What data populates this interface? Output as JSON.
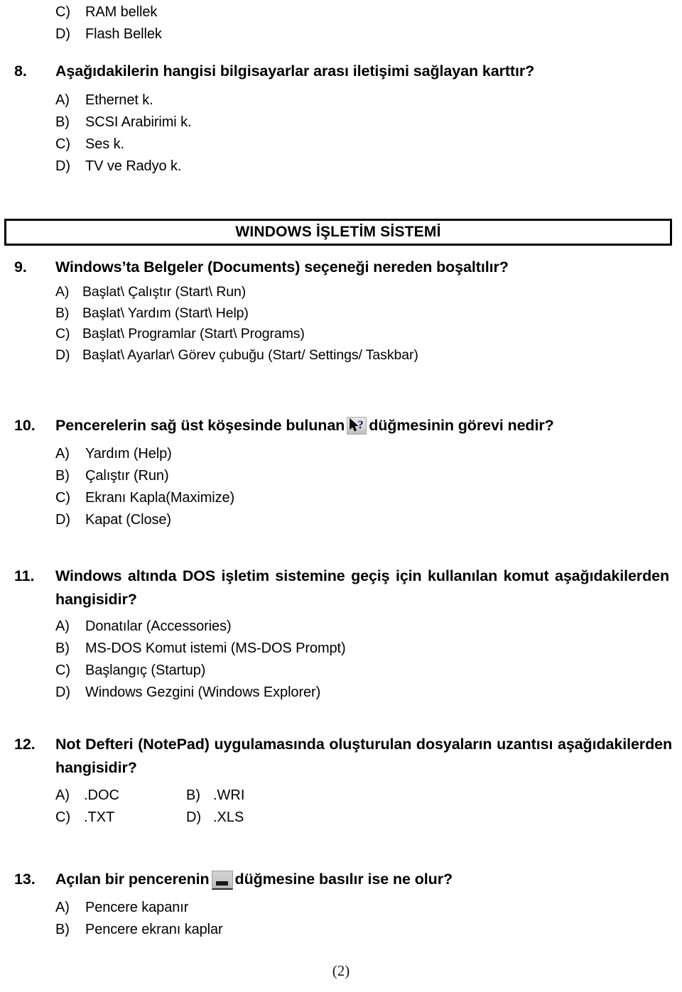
{
  "document": {
    "page_label": "(2)",
    "section_banner": "WINDOWS İŞLETİM SİSTEMİ"
  },
  "carryover_options": [
    {
      "letter": "C)",
      "text": "RAM bellek"
    },
    {
      "letter": "D)",
      "text": "Flash Bellek"
    }
  ],
  "questions": [
    {
      "number": "8.",
      "text": "Aşağıdakilerin hangisi bilgisayarlar arası iletişimi sağlayan karttır?",
      "options": [
        {
          "letter": "A)",
          "text": "Ethernet k."
        },
        {
          "letter": "B)",
          "text": "SCSI Arabirimi k."
        },
        {
          "letter": "C)",
          "text": "Ses k."
        },
        {
          "letter": "D)",
          "text": "TV ve Radyo k."
        }
      ]
    },
    {
      "number": "9.",
      "text": "Windows’ta Belgeler (Documents) seçeneği nereden boşaltılır?",
      "options": [
        {
          "letter": "A)",
          "text": "Başlat\\ Çalıştır (Start\\ Run)"
        },
        {
          "letter": "B)",
          "text": "Başlat\\ Yardım (Start\\ Help)"
        },
        {
          "letter": "C)",
          "text": "Başlat\\ Programlar (Start\\ Programs)"
        },
        {
          "letter": "D)",
          "text": "Başlat\\ Ayarlar\\ Görev çubuğu (Start/ Settings/ Taskbar)"
        }
      ]
    },
    {
      "number": "10.",
      "text_before_icon": "Pencerelerin sağ üst köşesinde bulunan",
      "icon": "help-cursor-icon",
      "text_after_icon": "düğmesinin görevi nedir?",
      "options": [
        {
          "letter": "A)",
          "text": "Yardım (Help)"
        },
        {
          "letter": "B)",
          "text": "Çalıştır (Run)"
        },
        {
          "letter": "C)",
          "text": "Ekranı Kapla(Maximize)"
        },
        {
          "letter": "D)",
          "text": "Kapat (Close)"
        }
      ]
    },
    {
      "number": "11.",
      "text": "Windows altında DOS işletim sistemine geçiş için kullanılan komut aşağıdakilerden hangisidir?",
      "options": [
        {
          "letter": "A)",
          "text": "Donatılar (Accessories)"
        },
        {
          "letter": "B)",
          "text": "MS-DOS Komut istemi (MS-DOS Prompt)"
        },
        {
          "letter": "C)",
          "text": "Başlangıç (Startup)"
        },
        {
          "letter": "D)",
          "text": "Windows Gezgini (Windows Explorer)"
        }
      ]
    },
    {
      "number": "12.",
      "text": "Not Defteri (NotePad) uygulamasında oluşturulan dosyaların uzantısı aşağıdakilerden hangisidir?",
      "options_grid": [
        [
          {
            "letter": "A)",
            "text": ".DOC"
          },
          {
            "letter": "B)",
            "text": ".WRI"
          }
        ],
        [
          {
            "letter": "C)",
            "text": ".TXT"
          },
          {
            "letter": "D)",
            "text": ".XLS"
          }
        ]
      ]
    },
    {
      "number": "13.",
      "text_before_icon": "Açılan bir pencerenin",
      "icon": "minimize-button-icon",
      "text_after_icon": "düğmesine basılır ise ne olur?",
      "options": [
        {
          "letter": "A)",
          "text": "Pencere kapanır"
        },
        {
          "letter": "B)",
          "text": "Pencere ekranı kaplar"
        }
      ]
    }
  ],
  "colors": {
    "text": "#000000",
    "page_background": "#ffffff",
    "banner_border": "#000000",
    "help_icon_question_mark": "#1b1b6e",
    "minimize_icon_face": "#c8c8c8"
  }
}
